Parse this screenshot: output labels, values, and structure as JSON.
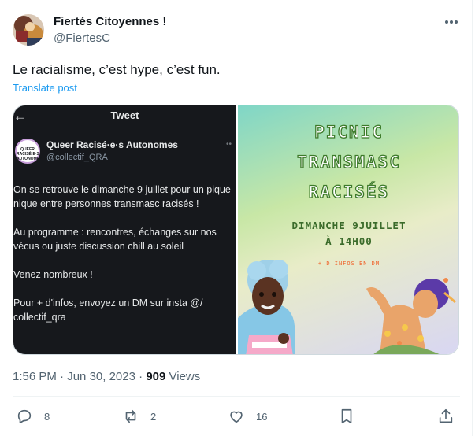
{
  "post": {
    "display_name": "Fiertés Citoyennes !",
    "handle": "@FiertesC",
    "text": "Le racialisme, c’est hype, c’est fun.",
    "translate_label": "Translate post",
    "time": "1:56 PM",
    "separator": " · ",
    "date": "Jun 30, 2023",
    "views_count": "909",
    "views_label": " Views"
  },
  "media": {
    "left": {
      "header_title": "Tweet",
      "logo_text": "QUEER RACISÉ·E·S AUTONOMES",
      "author_name": "Queer Racisé·e·s Autonomes",
      "author_handle": "@collectif_QRA",
      "body": "On se retrouve le dimanche 9 juillet pour un pique nique entre personnes transmasc racisés !\n\nAu programme : rencontres, échanges sur nos vécus ou juste discussion chill au soleil\n\nVenez nombreux !\n\nPour + d'infos, envoyez un DM sur insta @/ collectif_qra"
    },
    "right": {
      "title_line1": "PICNIC",
      "title_line2": "TRANSMASC",
      "title_line3": "RACISÉS",
      "date_line1": "DIMANCHE 9JUILLET",
      "date_line2": "À 14H00",
      "dm_note": "+ D'INFOS EN DM"
    }
  },
  "actions": {
    "replies": "8",
    "reposts": "2",
    "likes": "16"
  },
  "colors": {
    "accent": "#1d9bf0",
    "secondary_text": "#536471",
    "primary_text": "#0f1419"
  },
  "icons": [
    "more-icon",
    "back-arrow-icon",
    "reply-icon",
    "repost-icon",
    "like-icon",
    "bookmark-icon",
    "share-icon"
  ]
}
